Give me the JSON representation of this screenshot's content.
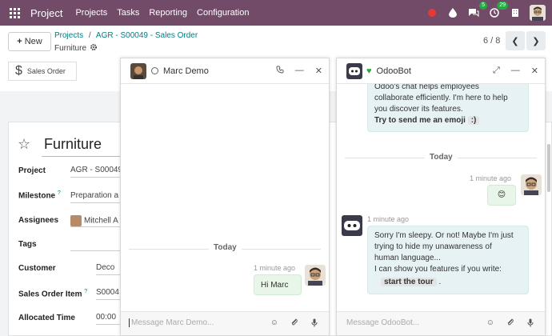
{
  "navbar": {
    "app_name": "Project",
    "menu": [
      "Projects",
      "Tasks",
      "Reporting",
      "Configuration"
    ],
    "badges": {
      "messages": "5",
      "activities": "29"
    }
  },
  "control": {
    "new_label": "New",
    "breadcrumb_projects": "Projects",
    "breadcrumb_sep": "/",
    "breadcrumb_order": "AGR - S00049 - Sales Order",
    "record_name": "Furniture",
    "pager": "6 / 8"
  },
  "smart_button": {
    "label": "Sales Order"
  },
  "form": {
    "title": "Furniture",
    "fields": [
      {
        "label": "Project",
        "value": "AGR - S00049"
      },
      {
        "label": "Milestone",
        "value": "Preparation a"
      },
      {
        "label": "Assignees",
        "value": "Mitchell A"
      },
      {
        "label": "Tags",
        "value": ""
      },
      {
        "label": "Customer",
        "value": "Deco"
      },
      {
        "label": "Sales Order Item",
        "value": "S0004"
      },
      {
        "label": "Allocated Time",
        "value": "00:00"
      }
    ],
    "help_mark": "?"
  },
  "chat_marc": {
    "title": "Marc Demo",
    "day_separator": "Today",
    "message_time": "1 minute ago",
    "message_text": "Hi Marc",
    "composer_placeholder": "Message Marc Demo..."
  },
  "chat_odoobot": {
    "title": "OdooBot",
    "intro_lines": [
      "Odoo's chat helps employees",
      "collaborate efficiently. I'm here to help",
      "you discover its features."
    ],
    "intro_try": "Try to send me an emoji",
    "intro_code": ":)",
    "day_separator": "Today",
    "my_time": "1 minute ago",
    "my_emoji": "😊",
    "bot_time": "1 minute ago",
    "bot_lines": [
      "Sorry I'm sleepy. Or not! Maybe I'm just",
      "trying to hide my unawareness of",
      "human language...",
      "I can show you features if you write:"
    ],
    "bot_code": "start the tour",
    "bot_end": ".",
    "composer_placeholder": "Message OdooBot..."
  },
  "colors": {
    "brand": "#714b67",
    "accent": "#017e84",
    "badge": "#28a745"
  }
}
